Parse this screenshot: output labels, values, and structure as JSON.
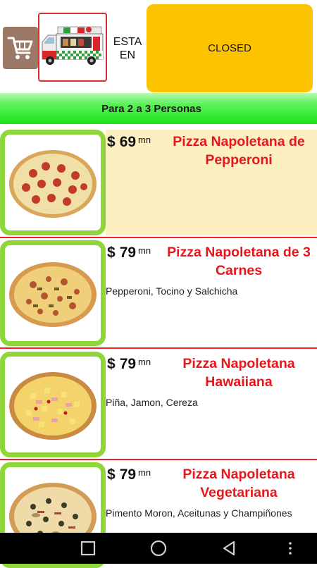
{
  "header": {
    "status_prefix": "ESTA EN",
    "status_value": "CLOSED"
  },
  "section": {
    "title": "Para 2 a 3 Personas"
  },
  "items": [
    {
      "currency": "$",
      "price": "69",
      "unit": "mn",
      "name": "Pizza Napoletana de Pepperoni",
      "description": "",
      "topping": "pepperoni",
      "highlighted": true
    },
    {
      "currency": "$",
      "price": "79",
      "unit": "mn",
      "name": "Pizza Napoletana de 3 Carnes",
      "description": "Pepperoni, Tocino y Salchicha",
      "topping": "meat",
      "highlighted": false
    },
    {
      "currency": "$",
      "price": "79",
      "unit": "mn",
      "name": "Pizza Napoletana Hawaiiana",
      "description": "Piña, Jamon, Cereza",
      "topping": "hawaiian",
      "highlighted": false
    },
    {
      "currency": "$",
      "price": "79",
      "unit": "mn",
      "name": "Pizza Napoletana Vegetariana",
      "description": "Pimento Moron, Aceitunas y Champiñones",
      "topping": "vegetarian",
      "highlighted": false
    }
  ],
  "icons": {
    "cart": "shopping-cart-icon",
    "truck": "food-truck-icon",
    "recents": "recents-square-icon",
    "home": "home-circle-icon",
    "back": "back-triangle-icon",
    "menu": "more-dots-icon"
  },
  "colors": {
    "closed_bg": "#fcc400",
    "section_bar": "#19e619",
    "title_red": "#e8161c",
    "thumb_border": "#8fd63a",
    "highlight_row": "#fdf0c0",
    "divider": "#ee2222",
    "cart_button": "#9c7966"
  }
}
